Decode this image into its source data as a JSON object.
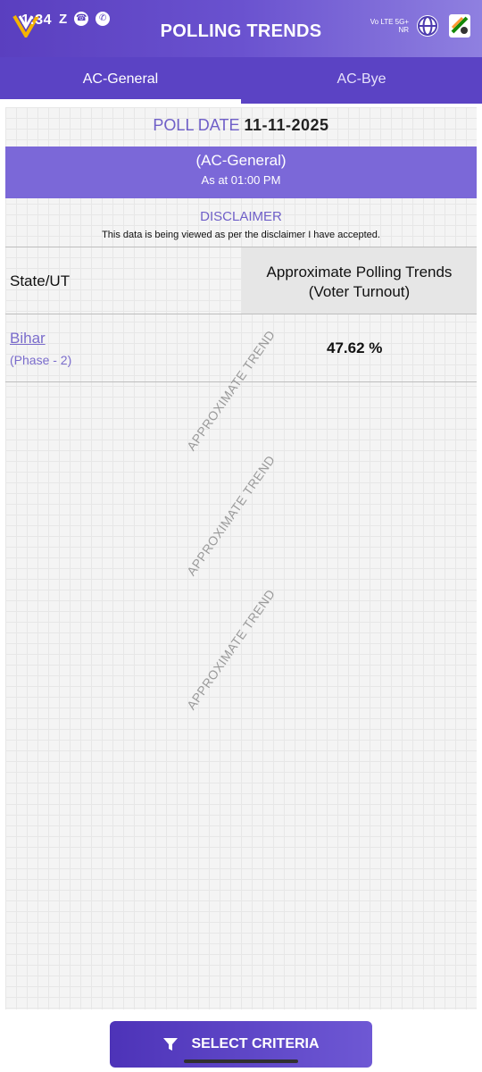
{
  "status": {
    "time": "1:34",
    "left_icons": [
      "Z"
    ],
    "network_text": "Vo LTE 5G+\nNR"
  },
  "header": {
    "title": "POLLING TRENDS"
  },
  "tabs": [
    {
      "label": "AC-General",
      "active": true
    },
    {
      "label": "AC-Bye",
      "active": false
    }
  ],
  "poll": {
    "date_label": "POLL DATE",
    "date_value": "11-11-2025"
  },
  "band": {
    "title": "(AC-General)",
    "subtitle": "As at 01:00 PM"
  },
  "disclaimer": {
    "title": "DISCLAIMER",
    "text": "This data is being viewed as per the disclaimer I have accepted."
  },
  "table": {
    "col_state": "State/UT",
    "col_turnout_line1": "Approximate Polling Trends",
    "col_turnout_line2": "(Voter Turnout)",
    "rows": [
      {
        "state": "Bihar",
        "phase": "(Phase - 2)",
        "turnout": "47.62 %"
      }
    ]
  },
  "watermark": "APPROXIMATE TREND",
  "button": {
    "label": "SELECT CRITERIA"
  },
  "colors": {
    "primary": "#5b43c4",
    "accent_text": "#6f5fc8",
    "band": "#7b68d8"
  }
}
